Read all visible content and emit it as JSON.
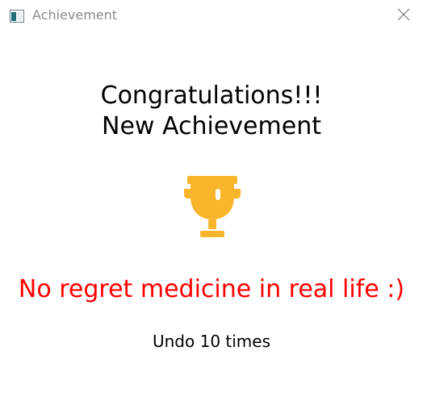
{
  "window": {
    "title": "Achievement",
    "app_icon": "window-app-icon",
    "close_icon": "close-icon"
  },
  "content": {
    "headline_line1": "Congratulations!!!",
    "headline_line2": "New Achievement",
    "trophy_icon": "trophy-icon",
    "slogan": "No regret medicine in real life :)",
    "detail": "Undo 10 times"
  },
  "colors": {
    "slogan": "#ff0000",
    "trophy": "#f9b52b",
    "title_text": "#8a8a8a"
  }
}
